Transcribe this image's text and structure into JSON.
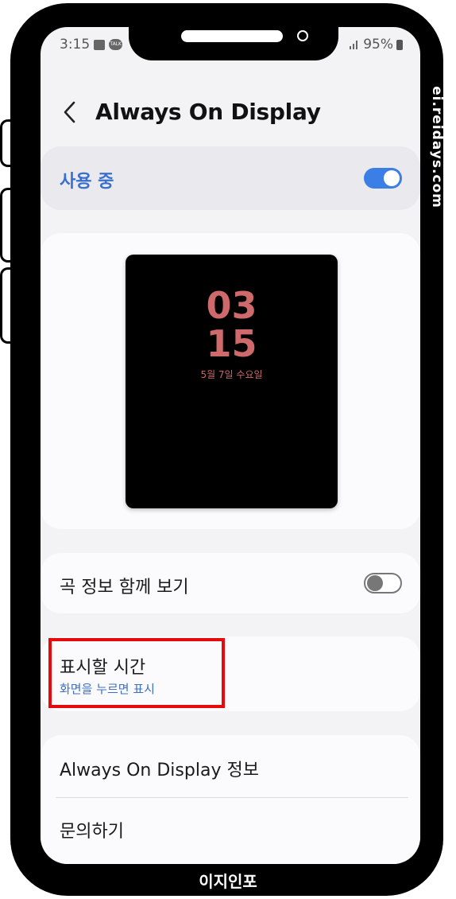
{
  "status_bar": {
    "time": "3:15",
    "talk_label": "TALK",
    "battery": "95%"
  },
  "header": {
    "title": "Always On Display"
  },
  "master_toggle": {
    "label": "사용 중",
    "on": true
  },
  "preview": {
    "hour": "03",
    "minute": "15",
    "date": "5월 7일 수요일"
  },
  "music_info": {
    "label": "곡 정보 함께 보기",
    "on": false
  },
  "display_time": {
    "title": "표시할 시간",
    "value": "화면을 누르면 표시"
  },
  "menu": {
    "about": "Always On Display 정보",
    "contact": "문의하기"
  },
  "watermark": "ei.reidays.com",
  "brand": "이지인포",
  "colors": {
    "accent": "#3a7ee6",
    "clock": "#cf6a6c",
    "highlight": "#e60a0a"
  }
}
